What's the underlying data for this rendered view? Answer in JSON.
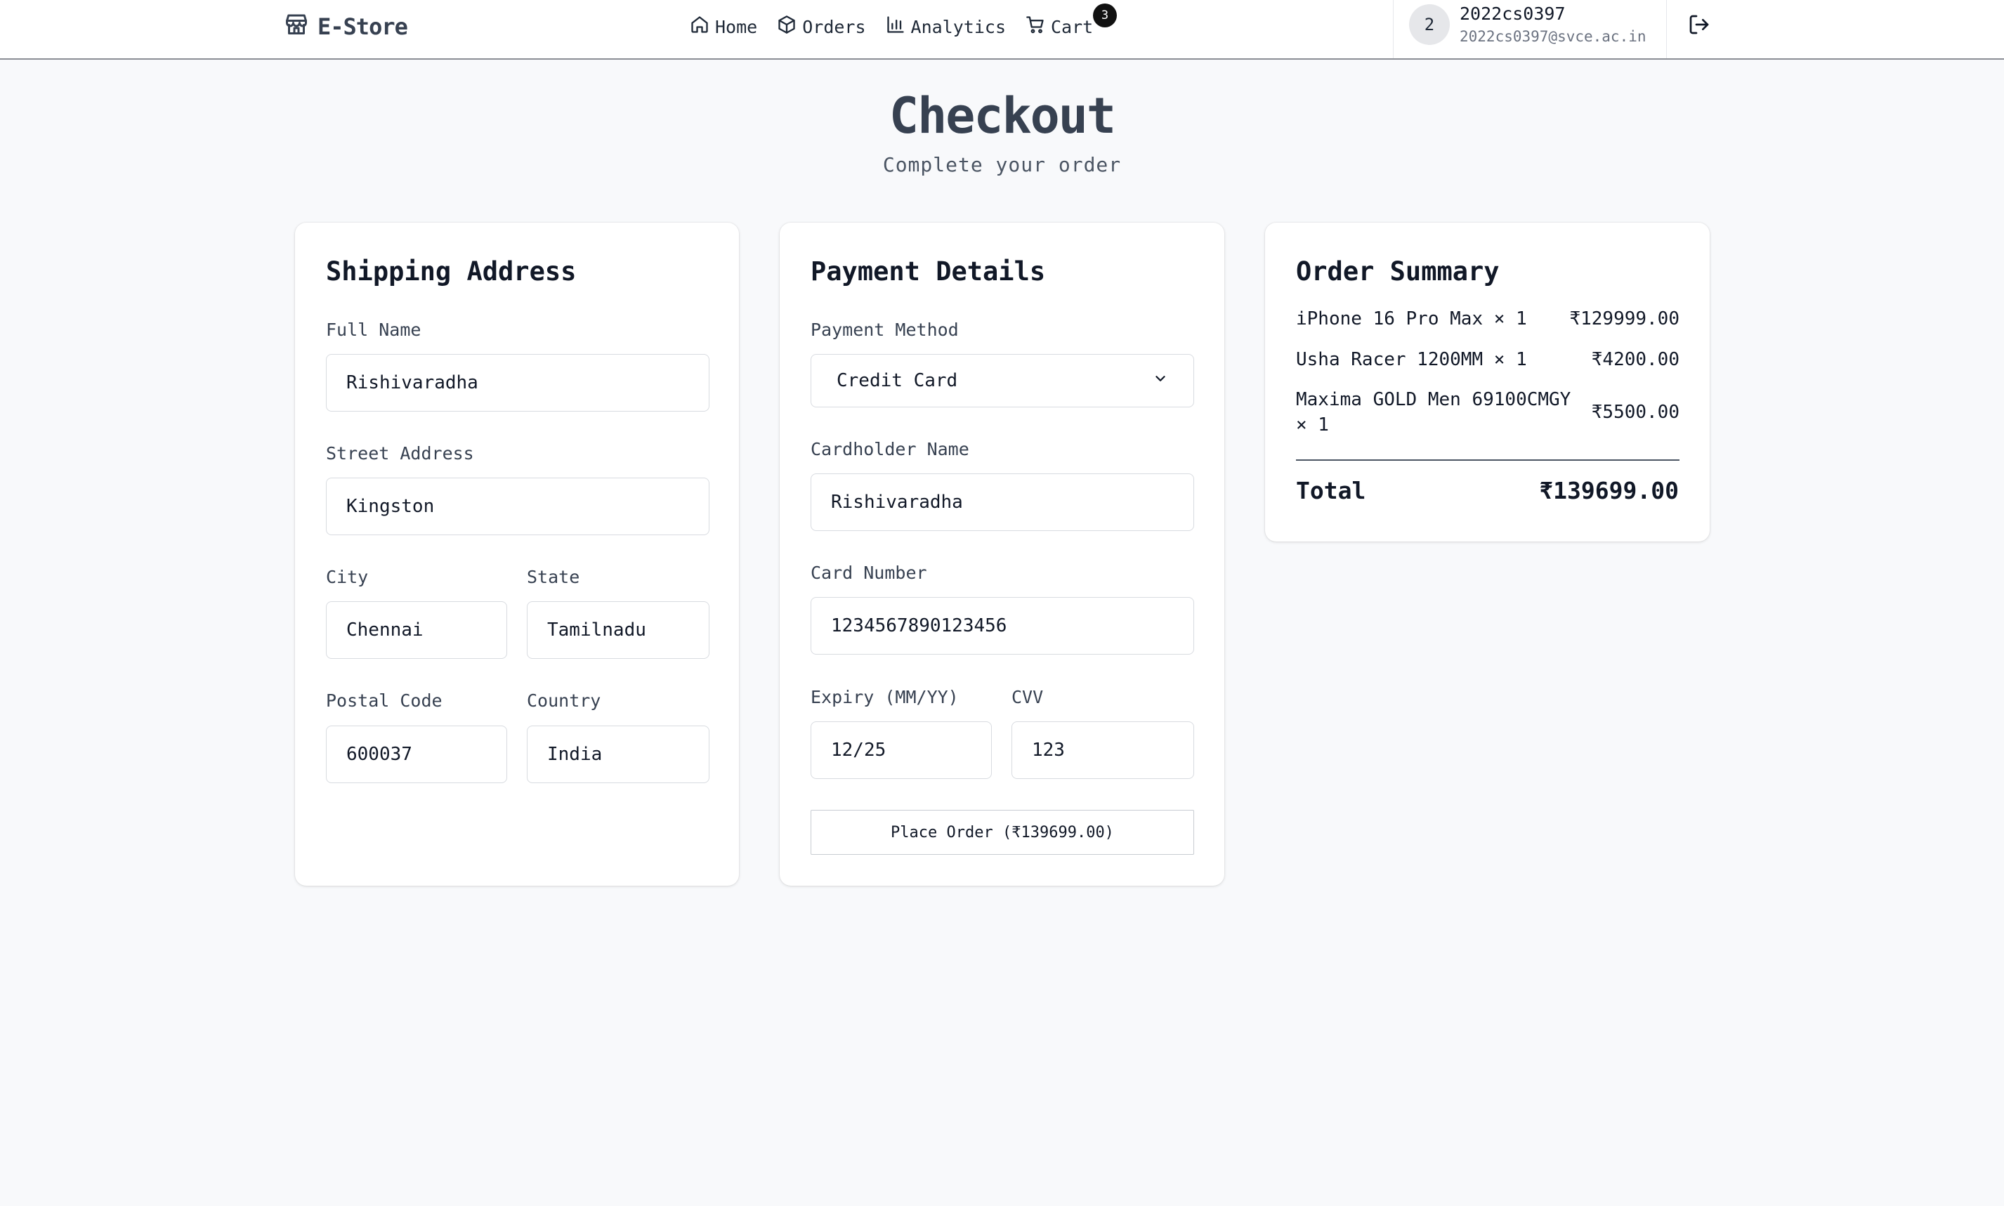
{
  "nav": {
    "brand": "E-Store",
    "items": [
      {
        "label": "Home",
        "icon": "home-icon"
      },
      {
        "label": "Orders",
        "icon": "box-icon"
      },
      {
        "label": "Analytics",
        "icon": "bar-chart-icon"
      },
      {
        "label": "Cart",
        "icon": "cart-icon"
      }
    ],
    "cart_count": "3",
    "user": {
      "avatar": "2",
      "name": "2022cs0397",
      "email": "2022cs0397@svce.ac.in"
    },
    "logout_icon": "logout-icon"
  },
  "page": {
    "title": "Checkout",
    "subtitle": "Complete your order"
  },
  "shipping": {
    "title": "Shipping Address",
    "full_name_label": "Full Name",
    "full_name": "Rishivaradha",
    "street_label": "Street Address",
    "street": "Kingston",
    "city_label": "City",
    "city": "Chennai",
    "state_label": "State",
    "state": "Tamilnadu",
    "postal_label": "Postal Code",
    "postal": "600037",
    "country_label": "Country",
    "country": "India"
  },
  "payment": {
    "title": "Payment Details",
    "method_label": "Payment Method",
    "method": "Credit Card",
    "holder_label": "Cardholder Name",
    "holder": "Rishivaradha",
    "card_label": "Card Number",
    "card": "1234567890123456",
    "expiry_label": "Expiry (MM/YY)",
    "expiry": "12/25",
    "cvv_label": "CVV",
    "cvv": "123",
    "place_order": "Place Order (₹139699.00)"
  },
  "summary": {
    "title": "Order Summary",
    "items": [
      {
        "name": "iPhone 16 Pro Max × 1",
        "price": "₹129999.00"
      },
      {
        "name": "Usha Racer 1200MM × 1",
        "price": "₹4200.00"
      },
      {
        "name": "Maxima GOLD Men 69100CMGY × 1",
        "price": "₹5500.00"
      }
    ],
    "total_label": "Total",
    "total": "₹139699.00"
  }
}
